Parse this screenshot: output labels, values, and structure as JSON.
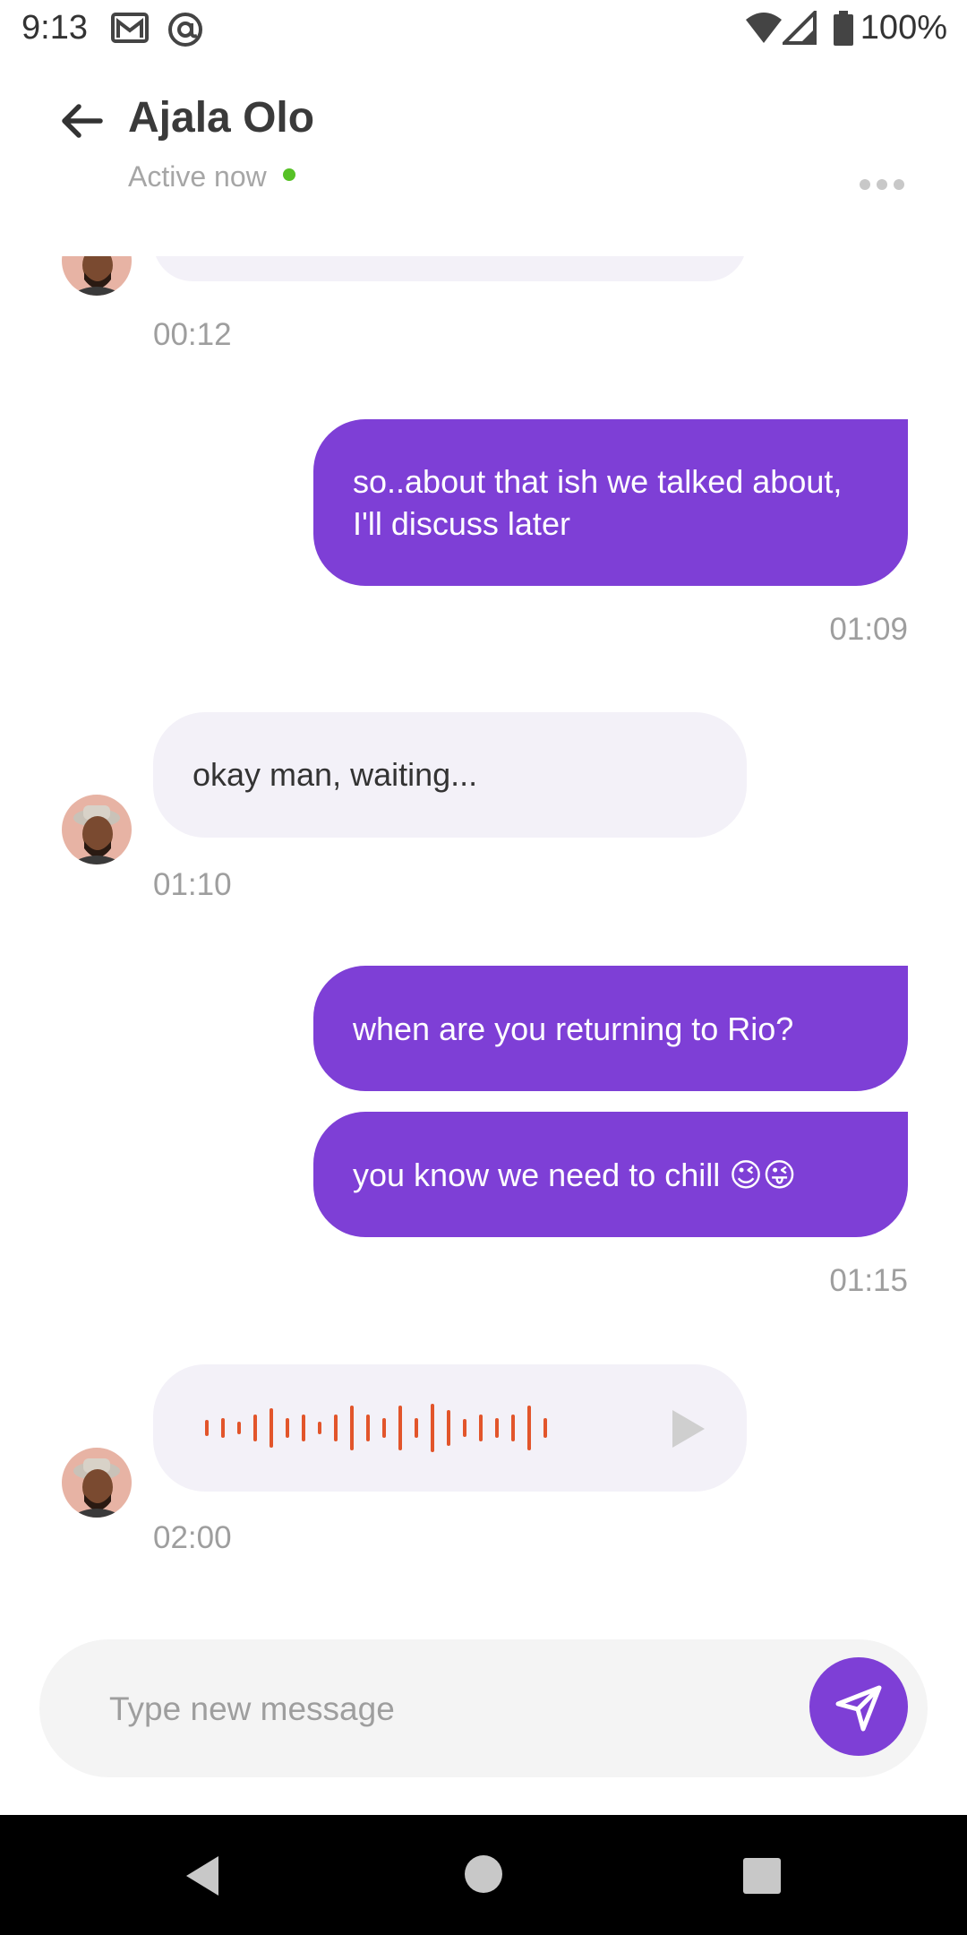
{
  "status_bar": {
    "time": "9:13",
    "battery_percent": "100%",
    "icons": [
      "gmail-icon",
      "at-sign-icon",
      "wifi-icon",
      "signal-icon",
      "battery-icon"
    ]
  },
  "header": {
    "contact_name": "Ajala Olo",
    "status": "Active now",
    "status_color": "#56c126"
  },
  "messages": [
    {
      "direction": "in",
      "type": "text",
      "text": "",
      "time": "00:12",
      "partial": true
    },
    {
      "direction": "out",
      "type": "text",
      "text": "so..about that ish we talked about, I'll discuss later",
      "time": "01:09"
    },
    {
      "direction": "in",
      "type": "text",
      "text": "okay man, waiting...",
      "time": "01:10"
    },
    {
      "direction": "out",
      "type": "text",
      "text": "when are you returning to Rio?",
      "time": ""
    },
    {
      "direction": "out",
      "type": "text",
      "text": "you know we need to chill 😉😜",
      "time": "01:15"
    },
    {
      "direction": "in",
      "type": "voice",
      "text": "",
      "time": "02:00"
    }
  ],
  "composer": {
    "placeholder": "Type new message"
  },
  "colors": {
    "accent": "#7e3fd6",
    "incoming_bubble": "#f3f1f8",
    "waveform": "#e2552b"
  },
  "nav_bar": {
    "icons": [
      "back-triangle-icon",
      "home-circle-icon",
      "recents-square-icon"
    ]
  }
}
